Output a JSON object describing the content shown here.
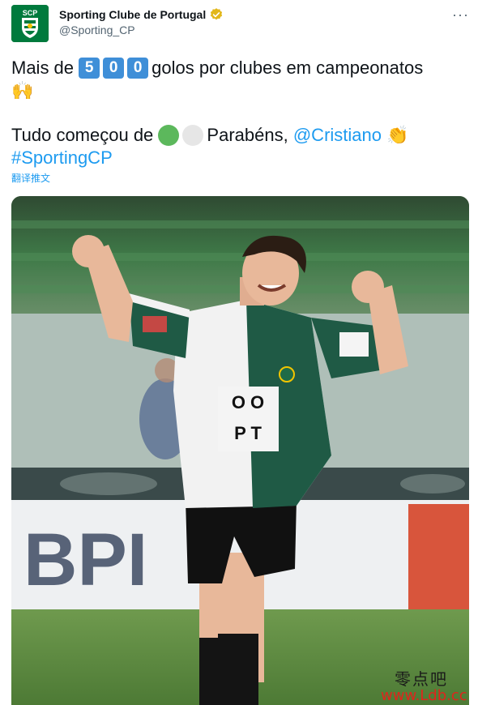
{
  "tweet": {
    "account": {
      "name": "Sporting Clube de Portugal",
      "handle": "@Sporting_CP",
      "avatar_initials": "SCP",
      "verified_icon": "verified-badge-icon",
      "brand_color": "#007a3d"
    },
    "more_icon": "···",
    "text": {
      "line1_prefix": "Mais de",
      "digits": [
        "5",
        "0",
        "0"
      ],
      "line1_suffix": "golos por clubes em campeonatos",
      "line2_emoji": "🙌",
      "line3_prefix": "Tudo começou de",
      "line3_circles": [
        "#5cb85c",
        "#e6e6e6"
      ],
      "line3_middle": "Parabéns,",
      "mention": "@Cristiano",
      "clap_emoji": "👏",
      "hashtag": "#SportingCP"
    },
    "translate_label": "翻译推文",
    "photo": {
      "shirt_sponsor_line1": "O O",
      "shirt_sponsor_line2": "P T",
      "board_text": "BPI"
    },
    "watermark": {
      "line1": "零点吧",
      "line2": "www.Ldb.cc"
    }
  }
}
